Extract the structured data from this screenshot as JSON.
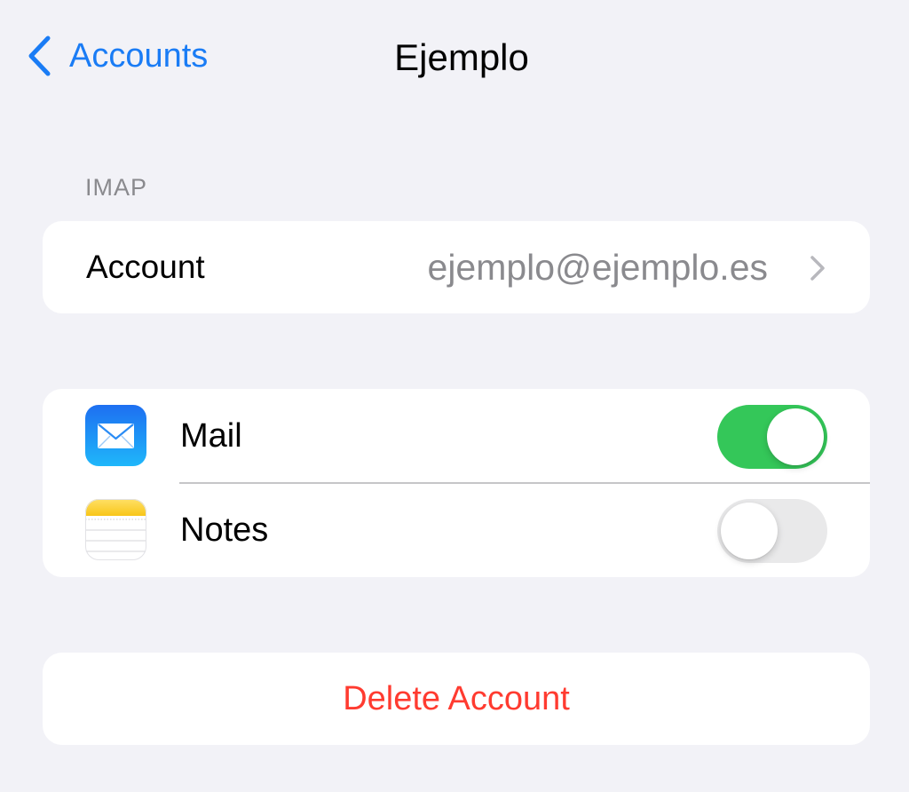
{
  "nav": {
    "back_label": "Accounts",
    "title": "Ejemplo",
    "back_icon": "chevron-left-icon"
  },
  "section": {
    "header": "IMAP"
  },
  "account": {
    "label": "Account",
    "value": "ejemplo@ejemplo.es",
    "icon": "chevron-right-icon"
  },
  "apps": [
    {
      "label": "Mail",
      "icon": "mail-app-icon",
      "enabled": true
    },
    {
      "label": "Notes",
      "icon": "notes-app-icon",
      "enabled": false
    }
  ],
  "delete": {
    "label": "Delete Account"
  },
  "colors": {
    "background": "#f2f2f7",
    "accent": "#1a7cf5",
    "toggle_on": "#34c759",
    "toggle_off": "#e9e9ea",
    "destructive": "#ff3b30",
    "secondary_text": "#8a8a8e"
  }
}
